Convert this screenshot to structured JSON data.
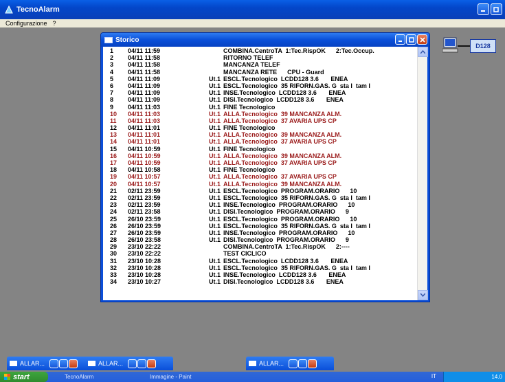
{
  "app": {
    "title": "TecnoAlarm"
  },
  "menu": {
    "items": [
      "Configurazione",
      "?"
    ]
  },
  "storico": {
    "title": "Storico",
    "rows": [
      {
        "n": "1",
        "date": "04/11 11:59",
        "ut": "",
        "msg": "COMBINA.CentroTA  1:Tec.RispOK      2:Tec.Occup.",
        "red": false
      },
      {
        "n": "2",
        "date": "04/11 11:58",
        "ut": "",
        "msg": "RITORNO TELEF",
        "red": false
      },
      {
        "n": "3",
        "date": "04/11 11:58",
        "ut": "",
        "msg": "MANCANZA TELEF",
        "red": false
      },
      {
        "n": "4",
        "date": "04/11 11:58",
        "ut": "",
        "msg": "MANCANZA RETE      CPU - Guard",
        "red": false
      },
      {
        "n": "5",
        "date": "04/11 11:09",
        "ut": "Ut.1",
        "msg": "ESCL.Tecnologico  LCDD128 3.6       ENEA",
        "red": false
      },
      {
        "n": "6",
        "date": "04/11 11:09",
        "ut": "Ut.1",
        "msg": "ESCL.Tecnologico  35 RIFORN.GAS. G  sta l  tam l",
        "red": false
      },
      {
        "n": "7",
        "date": "04/11 11:09",
        "ut": "Ut.1",
        "msg": "INSE.Tecnologico  LCDD128 3.6       ENEA",
        "red": false
      },
      {
        "n": "8",
        "date": "04/11 11:09",
        "ut": "Ut.1",
        "msg": "DISI.Tecnologico  LCDD128 3.6       ENEA",
        "red": false
      },
      {
        "n": "9",
        "date": "04/11 11:03",
        "ut": "Ut.1",
        "msg": "FINE Tecnologico",
        "red": false
      },
      {
        "n": "10",
        "date": "04/11 11:03",
        "ut": "Ut.1",
        "msg": "ALLA.Tecnologico  39 MANCANZA ALM.",
        "red": true
      },
      {
        "n": "11",
        "date": "04/11 11:03",
        "ut": "Ut.1",
        "msg": "ALLA.Tecnologico  37 AVARIA UPS CP",
        "red": true
      },
      {
        "n": "12",
        "date": "04/11 11:01",
        "ut": "Ut.1",
        "msg": "FINE Tecnologico",
        "red": false
      },
      {
        "n": "13",
        "date": "04/11 11:01",
        "ut": "Ut.1",
        "msg": "ALLA.Tecnologico  39 MANCANZA ALM.",
        "red": true
      },
      {
        "n": "14",
        "date": "04/11 11:01",
        "ut": "Ut.1",
        "msg": "ALLA.Tecnologico  37 AVARIA UPS CP",
        "red": true
      },
      {
        "n": "15",
        "date": "04/11 10:59",
        "ut": "Ut.1",
        "msg": "FINE Tecnologico",
        "red": false
      },
      {
        "n": "16",
        "date": "04/11 10:59",
        "ut": "Ut.1",
        "msg": "ALLA.Tecnologico  39 MANCANZA ALM.",
        "red": true
      },
      {
        "n": "17",
        "date": "04/11 10:59",
        "ut": "Ut.1",
        "msg": "ALLA.Tecnologico  37 AVARIA UPS CP",
        "red": true
      },
      {
        "n": "18",
        "date": "04/11 10:58",
        "ut": "Ut.1",
        "msg": "FINE Tecnologico",
        "red": false
      },
      {
        "n": "19",
        "date": "04/11 10:57",
        "ut": "Ut.1",
        "msg": "ALLA.Tecnologico  37 AVARIA UPS CP",
        "red": true
      },
      {
        "n": "20",
        "date": "04/11 10:57",
        "ut": "Ut.1",
        "msg": "ALLA.Tecnologico  39 MANCANZA ALM.",
        "red": true
      },
      {
        "n": "21",
        "date": "02/11 23:59",
        "ut": "Ut.1",
        "msg": "ESCL.Tecnologico  PROGRAM.ORARIO      10",
        "red": false
      },
      {
        "n": "22",
        "date": "02/11 23:59",
        "ut": "Ut.1",
        "msg": "ESCL.Tecnologico  35 RIFORN.GAS. G  sta l  tam l",
        "red": false
      },
      {
        "n": "23",
        "date": "02/11 23:59",
        "ut": "Ut.1",
        "msg": "INSE.Tecnologico  PROGRAM.ORARIO      10",
        "red": false
      },
      {
        "n": "24",
        "date": "02/11 23:58",
        "ut": "Ut.1",
        "msg": "DISI.Tecnologico  PROGRAM.ORARIO      9",
        "red": false
      },
      {
        "n": "25",
        "date": "26/10 23:59",
        "ut": "Ut.1",
        "msg": "ESCL.Tecnologico  PROGRAM.ORARIO      10",
        "red": false
      },
      {
        "n": "26",
        "date": "26/10 23:59",
        "ut": "Ut.1",
        "msg": "ESCL.Tecnologico  35 RIFORN.GAS. G  sta l  tam l",
        "red": false
      },
      {
        "n": "27",
        "date": "26/10 23:59",
        "ut": "Ut.1",
        "msg": "INSE.Tecnologico  PROGRAM.ORARIO      10",
        "red": false
      },
      {
        "n": "28",
        "date": "26/10 23:58",
        "ut": "Ut.1",
        "msg": "DISI.Tecnologico  PROGRAM.ORARIO      9",
        "red": false
      },
      {
        "n": "29",
        "date": "23/10 22:22",
        "ut": "",
        "msg": "COMBINA.CentroTA  1:Tec.RispOK      2:----",
        "red": false
      },
      {
        "n": "30",
        "date": "23/10 22:22",
        "ut": "",
        "msg": "TEST CICLICO",
        "red": false
      },
      {
        "n": "31",
        "date": "23/10 10:28",
        "ut": "Ut.1",
        "msg": "ESCL.Tecnologico  LCDD128 3.6       ENEA",
        "red": false
      },
      {
        "n": "32",
        "date": "23/10 10:28",
        "ut": "Ut.1",
        "msg": "ESCL.Tecnologico  35 RIFORN.GAS. G  sta l  tam l",
        "red": false
      },
      {
        "n": "33",
        "date": "23/10 10:28",
        "ut": "Ut.1",
        "msg": "INSE.Tecnologico  LCDD128 3.6       ENEA",
        "red": false
      },
      {
        "n": "34",
        "date": "23/10 10:27",
        "ut": "Ut.1",
        "msg": "DISI.Tecnologico  LCDD128 3.6       ENEA",
        "red": false
      }
    ]
  },
  "device": {
    "label": "D128"
  },
  "minimized": [
    {
      "name": "ALLAR..."
    },
    {
      "name": "ALLAR..."
    },
    {
      "name": "ALLAR..."
    }
  ],
  "taskbar": {
    "start": "start",
    "tasks": [
      "TecnoAlarm",
      "Immagine - Paint"
    ],
    "lang": "IT",
    "clock": "14.0"
  },
  "colors": {
    "alarm_red": "#9a1a1a",
    "xp_blue": "#0a4fd9",
    "desktop": "#848484"
  }
}
